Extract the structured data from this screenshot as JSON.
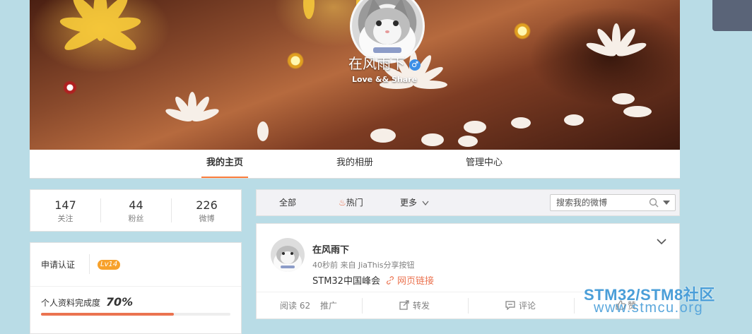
{
  "profile": {
    "name": "在风雨下",
    "gender_symbol": "♂",
    "bio": "Love && Share"
  },
  "nav": {
    "tabs": [
      {
        "label": "我的主页",
        "active": true
      },
      {
        "label": "我的相册",
        "active": false
      },
      {
        "label": "管理中心",
        "active": false
      }
    ]
  },
  "stats": [
    {
      "value": "147",
      "label": "关注"
    },
    {
      "value": "44",
      "label": "粉丝"
    },
    {
      "value": "226",
      "label": "微博"
    }
  ],
  "verify": {
    "label": "申请认证",
    "level": "Lv14"
  },
  "completion": {
    "label": "个人资料完成度",
    "percent_text": "70%",
    "fraction": 0.7
  },
  "filter": {
    "all": "全部",
    "hot": "热门",
    "more": "更多",
    "search_placeholder": "搜索我的微博"
  },
  "post": {
    "author": "在风雨下",
    "meta": "40秒前 来自 JiaThis分享按钮",
    "text": "STM32中国峰会",
    "link_label": "网页链接",
    "actions": {
      "read": "阅读 62",
      "promote": "推广",
      "repost": "转发",
      "comment": "评论",
      "like": "赞"
    }
  },
  "watermark": {
    "brand": "STM32/STM8社区",
    "url": "www.stmcu.org"
  },
  "colors": {
    "accent": "#fa7d3c",
    "link": "#eb7350",
    "level_badge": "#f7a12b",
    "page_bg": "#b9dce6"
  }
}
